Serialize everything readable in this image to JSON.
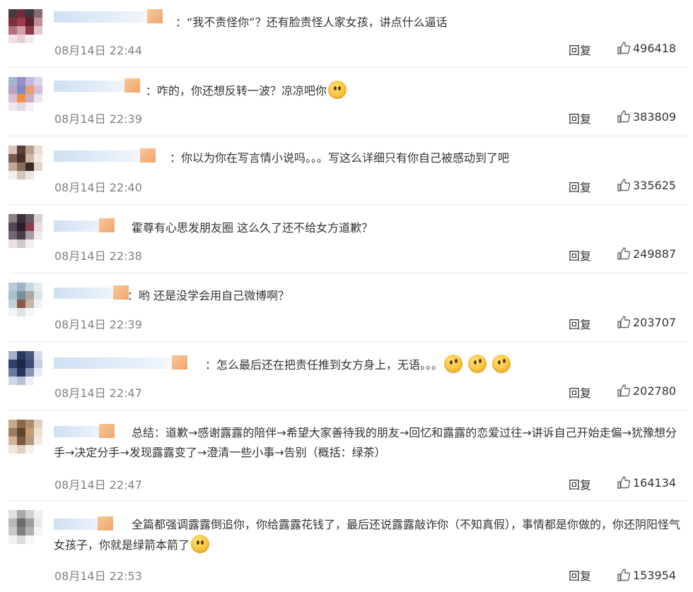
{
  "comments": [
    {
      "text": "：“我不责怪你”？还有脸责怪人家女孩，讲点什么逼话",
      "time": "08月14日 22:44",
      "reply": "回复",
      "likes": "496418",
      "emoji": []
    },
    {
      "text": "：咋的，你还想反转一波？凉凉吧你",
      "time": "08月14日 22:39",
      "reply": "回复",
      "likes": "383809",
      "emoji": [
        "smile-emoji"
      ]
    },
    {
      "text": "：你以为你在写言情小说吗。。。写这么详细只有你自己被感动到了吧",
      "time": "08月14日 22:40",
      "reply": "回复",
      "likes": "335625",
      "emoji": []
    },
    {
      "text": "霍尊有心思发朋友圈 这么久了还不给女方道歉？",
      "time": "08月14日 22:38",
      "reply": "回复",
      "likes": "249887",
      "emoji": []
    },
    {
      "text": "：哟 还是没学会用自己微博啊？",
      "time": "08月14日 22:39",
      "reply": "回复",
      "likes": "203707",
      "emoji": []
    },
    {
      "text": "：怎么最后还在把责任推到女方身上，无语。。。",
      "time": "08月14日 22:47",
      "reply": "回复",
      "likes": "202780",
      "emoji": [
        "sweat-emoji",
        "sweat-emoji",
        "sweat-emoji"
      ]
    },
    {
      "text": "总结：道歉→感谢露露的陪伴→希望大家善待我的朋友→回忆和露露的恋爱过往→讲诉自己开始走偏→犹豫想分手→决定分手→发现露露变了→澄清一些小事→告别（概括：绿茶）",
      "time": "08月14日 22:47",
      "reply": "回复",
      "likes": "164134",
      "emoji": []
    },
    {
      "text": "全篇都强调露露倒追你，你给露露花钱了，最后还说露露敲诈你（不知真假），事情都是你做的，你还阴阳怪气女孩子，你就是绿箭本箭了",
      "time": "08月14日 22:53",
      "reply": "回复",
      "likes": "153954",
      "emoji": [
        "blush-emoji"
      ]
    }
  ],
  "colors": {
    "text": "#333333",
    "time": "#808080",
    "divider": "#e6e6e6"
  },
  "icons": {
    "like": "thumbs-up-icon"
  }
}
